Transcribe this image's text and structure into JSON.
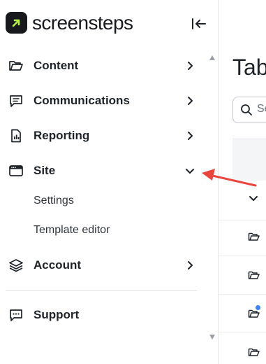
{
  "brand": {
    "name": "screensteps",
    "mark_color": "#17191c",
    "accent": "#b7f24a"
  },
  "sidebar": {
    "collapse_icon": "collapse-left-icon",
    "items": [
      {
        "label": "Content",
        "icon": "folder-icon",
        "chevron": "chevron-right"
      },
      {
        "label": "Communications",
        "icon": "chat-icon",
        "chevron": "chevron-right"
      },
      {
        "label": "Reporting",
        "icon": "report-doc-icon",
        "chevron": "chevron-right"
      },
      {
        "label": "Site",
        "icon": "browser-window-icon",
        "chevron": "chevron-down",
        "expanded": true,
        "children": [
          {
            "label": "Settings"
          },
          {
            "label": "Template editor"
          }
        ]
      },
      {
        "label": "Account",
        "icon": "layers-icon",
        "chevron": "chevron-right"
      }
    ],
    "footer_item": {
      "label": "Support",
      "icon": "support-chat-icon"
    }
  },
  "main": {
    "title": "Tab",
    "search": {
      "value": "Se",
      "placeholder": ""
    },
    "row_icons": [
      "chevron-down-icon",
      "folder-icon",
      "folder-icon",
      "folder-icon",
      "folder-icon"
    ],
    "unread_dot_color": "#3b82f6"
  },
  "annotation": {
    "color": "#e8453c"
  }
}
